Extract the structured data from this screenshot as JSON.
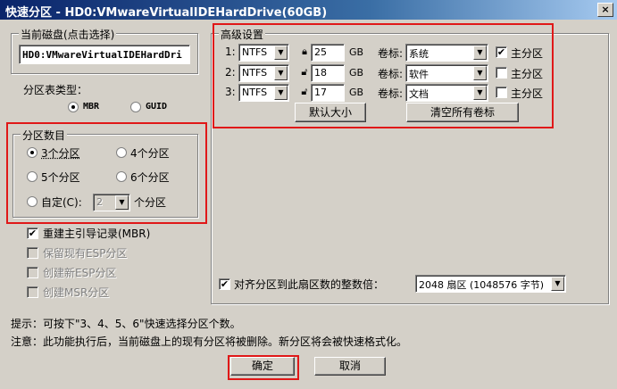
{
  "window": {
    "title": "快速分区 - HD0:VMwareVirtualIDEHardDrive(60GB)",
    "close": "×"
  },
  "disk": {
    "label": "当前磁盘(点击选择)",
    "value": "HD0:VMwareVirtualIDEHardDri"
  },
  "table_type": {
    "label": "分区表类型：",
    "options": [
      "MBR",
      "GUID"
    ],
    "selected": "MBR"
  },
  "count": {
    "label": "分区数目",
    "options": [
      "3个分区",
      "4个分区",
      "5个分区",
      "6个分区",
      "自定(C):"
    ],
    "selected": "3个分区",
    "custom_value": "2",
    "custom_suffix": "个分区"
  },
  "options": [
    {
      "label": "重建主引导记录(MBR)",
      "checked": true,
      "enabled": true
    },
    {
      "label": "保留现有ESP分区",
      "checked": false,
      "enabled": false
    },
    {
      "label": "创建新ESP分区",
      "checked": false,
      "enabled": false
    },
    {
      "label": "创建MSR分区",
      "checked": false,
      "enabled": false
    }
  ],
  "advanced": {
    "label": "高级设置",
    "rows": [
      {
        "num": "1:",
        "fs": "NTFS",
        "size": "25",
        "unit": "GB",
        "vol_label": "卷标:",
        "vol": "系统",
        "primary_label": "主分区",
        "primary": true
      },
      {
        "num": "2:",
        "fs": "NTFS",
        "size": "18",
        "unit": "GB",
        "vol_label": "卷标:",
        "vol": "软件",
        "primary_label": "主分区",
        "primary": false
      },
      {
        "num": "3:",
        "fs": "NTFS",
        "size": "17",
        "unit": "GB",
        "vol_label": "卷标:",
        "vol": "文档",
        "primary_label": "主分区",
        "primary": false
      }
    ],
    "default_size_btn": "默认大小",
    "clear_labels_btn": "清空所有卷标"
  },
  "align": {
    "label": "对齐分区到此扇区数的整数倍：",
    "checked": true,
    "value": "2048 扇区 (1048576 字节)"
  },
  "hints": [
    "提示：可按下\"3、4、5、6\"快速选择分区个数。",
    "注意：此功能执行后，当前磁盘上的现有分区将被删除。新分区将会被快速格式化。"
  ],
  "buttons": {
    "ok": "确定",
    "cancel": "取消"
  },
  "colors": {
    "highlight": "#e01818",
    "title_bar": "#0a246a"
  }
}
